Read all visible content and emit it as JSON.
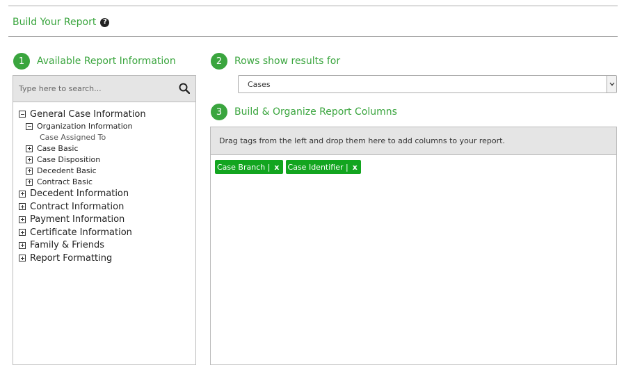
{
  "header": {
    "title": "Build Your Report",
    "help_icon": "?"
  },
  "steps": [
    {
      "number": "1",
      "label": "Available Report Information"
    },
    {
      "number": "2",
      "label": "Rows show results for"
    },
    {
      "number": "3",
      "label": "Build & Organize Report Columns"
    }
  ],
  "search": {
    "placeholder": "Type here to search..."
  },
  "tree": {
    "general": "General Case Information",
    "org_info": "Organization Information",
    "case_assigned_to": "Case Assigned To",
    "case_basic": "Case Basic",
    "case_disposition": "Case Disposition",
    "decedent_basic": "Decedent Basic",
    "contract_basic": "Contract Basic",
    "decedent_info": "Decedent Information",
    "contract_info": "Contract Information",
    "payment_info": "Payment Information",
    "certificate_info": "Certificate Information",
    "family_friends": "Family & Friends",
    "report_formatting": "Report Formatting"
  },
  "rows_select": {
    "value": "Cases"
  },
  "columns": {
    "hint": "Drag tags from the left and drop them here to add columns to your report.",
    "tags": [
      {
        "label": "Case Branch |",
        "remove": "x"
      },
      {
        "label": "Case Identifier |",
        "remove": "x"
      }
    ]
  },
  "colors": {
    "accent": "#3aa53e",
    "tag": "#12a51f"
  }
}
